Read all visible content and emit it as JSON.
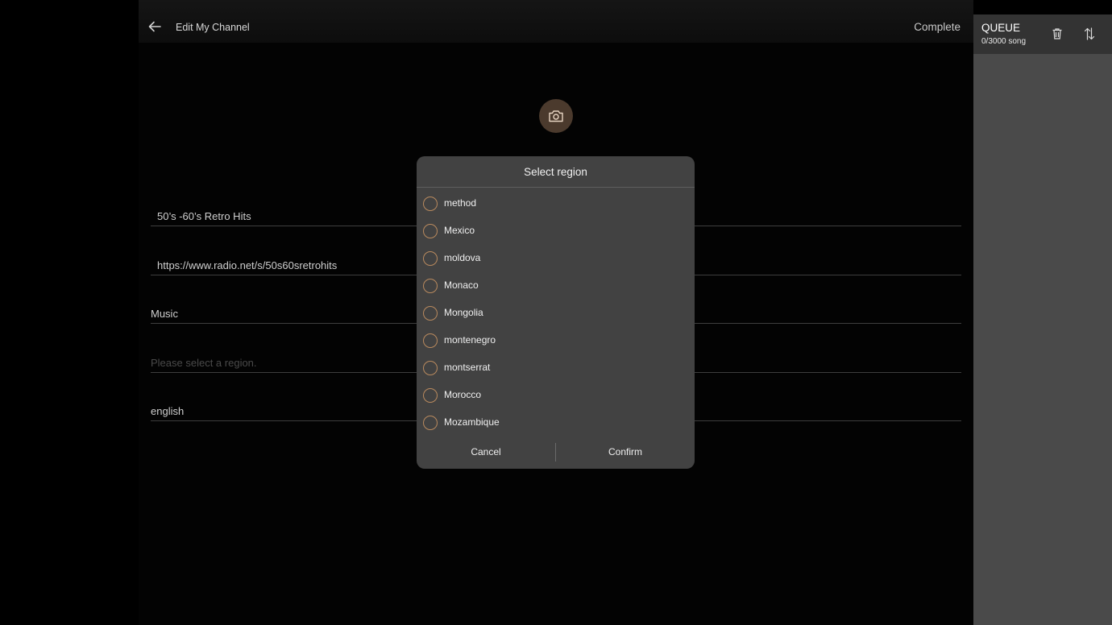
{
  "header": {
    "title": "Edit My Channel",
    "complete_label": "Complete"
  },
  "form": {
    "name_value": "50’s -60’s Retro Hits",
    "url_value": "https://www.radio.net/s/50s60sretrohits",
    "genre_value": "Music",
    "region_placeholder": "Please select a region.",
    "language_value": "english"
  },
  "queue": {
    "title": "QUEUE",
    "count": "0/3000 song"
  },
  "dialog": {
    "title": "Select region",
    "options": [
      "method",
      "Mexico",
      "moldova",
      "Monaco",
      "Mongolia",
      "montenegro",
      "montserrat",
      "Morocco",
      "Mozambique"
    ],
    "cancel_label": "Cancel",
    "confirm_label": "Confirm"
  },
  "colors": {
    "accent": "#b98a5e",
    "avatar_bg": "#4b3a2d",
    "dialog_bg": "#424242",
    "queue_bg": "#4a4a4a"
  }
}
